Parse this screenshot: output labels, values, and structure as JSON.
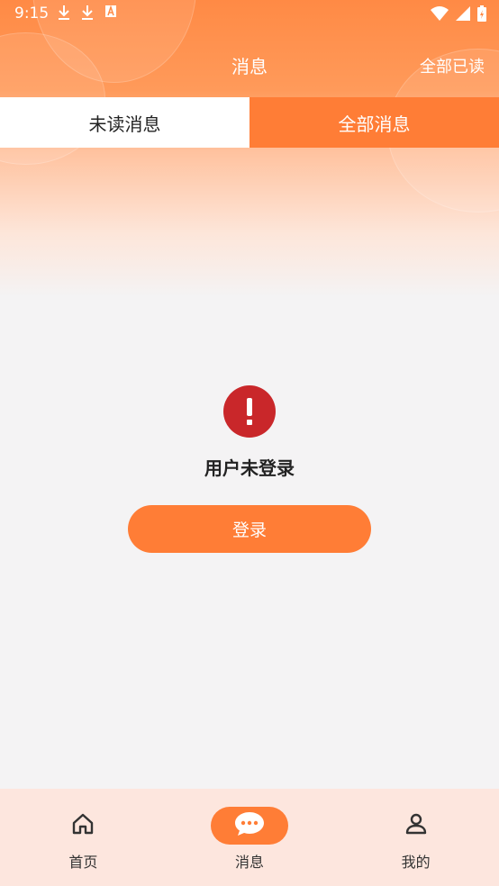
{
  "status_bar": {
    "time": "9:15",
    "left_icons": [
      "download-icon",
      "download-icon",
      "font-icon"
    ],
    "right_icons": [
      "wifi-icon",
      "signal-icon",
      "battery-icon"
    ]
  },
  "header": {
    "title": "消息",
    "mark_all_read": "全部已读"
  },
  "tabs": [
    {
      "label": "未读消息",
      "active": false
    },
    {
      "label": "全部消息",
      "active": true
    }
  ],
  "empty_state": {
    "icon": "alert-icon",
    "message": "用户未登录",
    "login_button": "登录"
  },
  "bottom_nav": [
    {
      "label": "首页",
      "icon": "home-icon",
      "active": false
    },
    {
      "label": "消息",
      "icon": "chat-icon",
      "active": true
    },
    {
      "label": "我的",
      "icon": "person-icon",
      "active": false
    }
  ],
  "colors": {
    "accent": "#ff7d36",
    "alert": "#c9272a",
    "nav_background": "#fde6de",
    "page_background": "#f4f3f4"
  }
}
